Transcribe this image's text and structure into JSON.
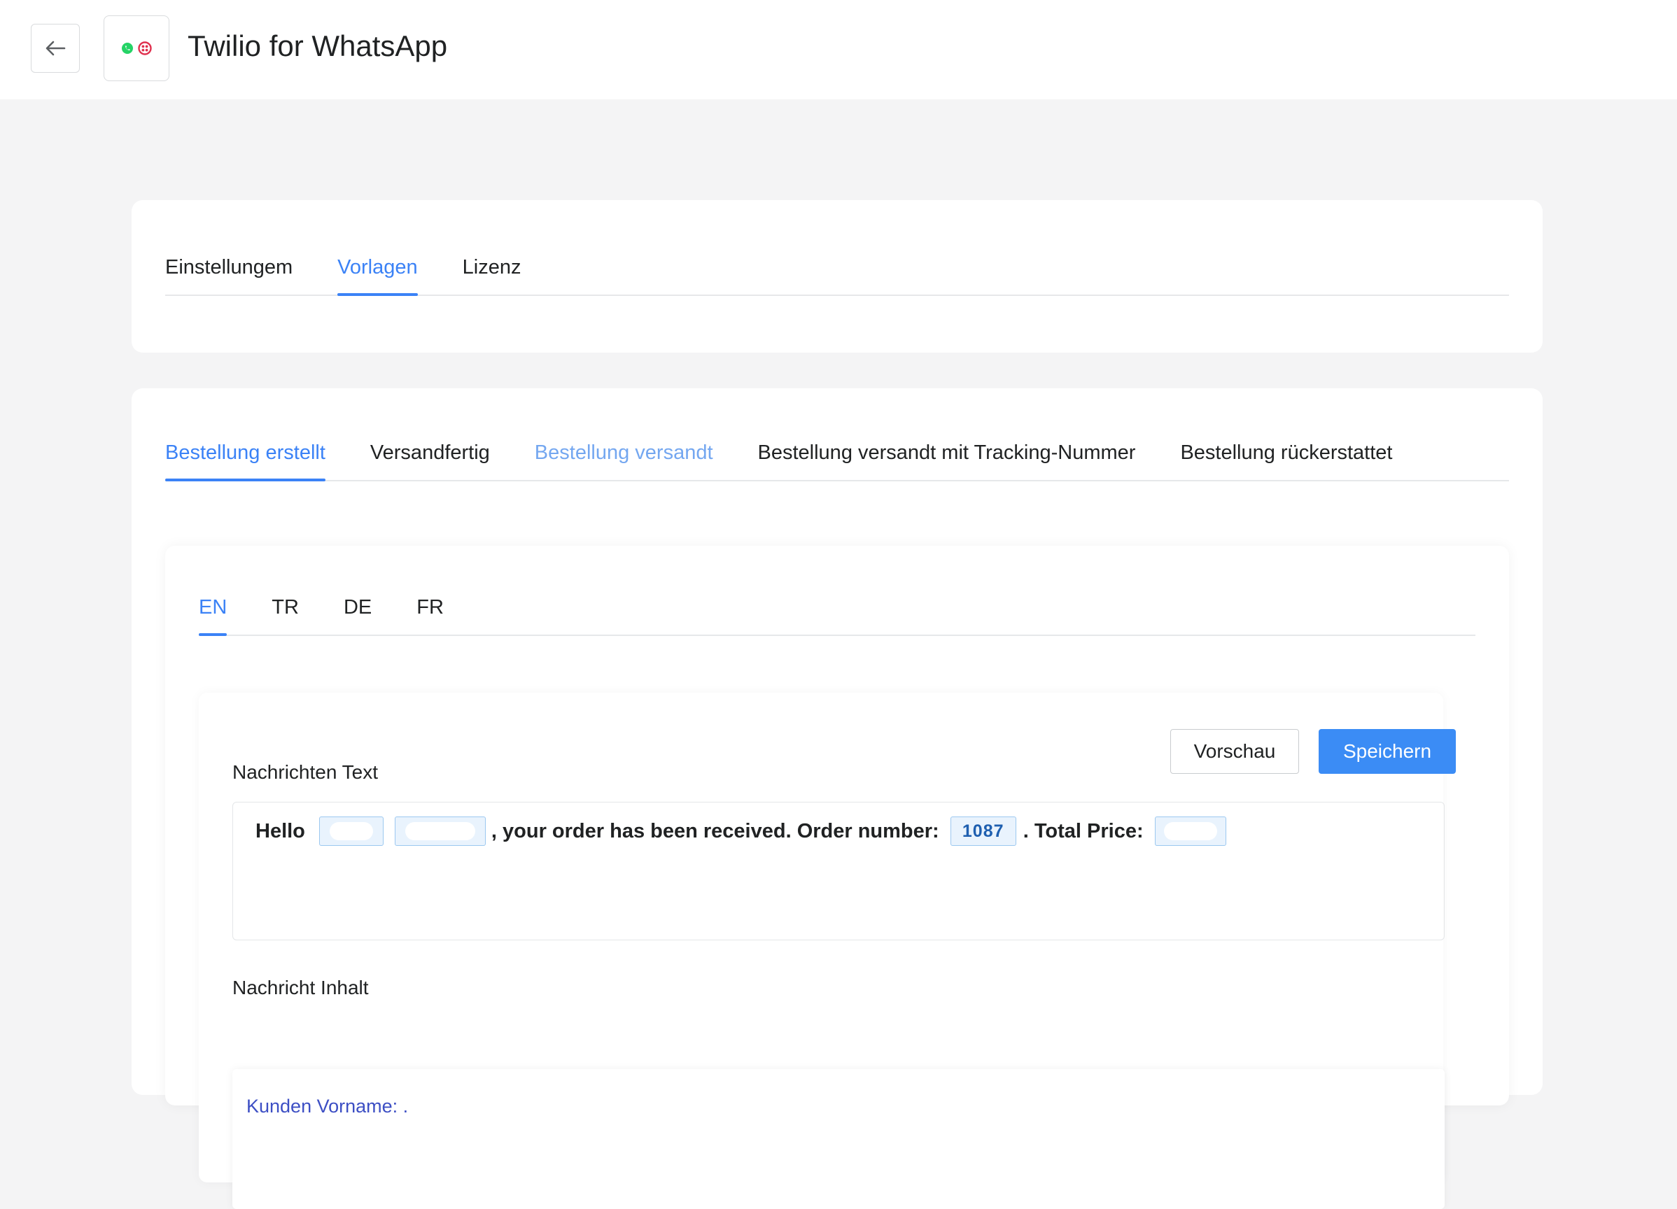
{
  "header": {
    "title": "Twilio for WhatsApp",
    "back_icon": "arrow-left-icon",
    "logo_icons": [
      "whatsapp-icon",
      "twilio-icon"
    ]
  },
  "main_tabs": [
    {
      "label": "Einstellungem",
      "active": false
    },
    {
      "label": "Vorlagen",
      "active": true
    },
    {
      "label": "Lizenz",
      "active": false
    }
  ],
  "event_tabs": [
    {
      "label": "Bestellung erstellt",
      "active": true
    },
    {
      "label": "Versandfertig",
      "active": false
    },
    {
      "label": "Bestellung versandt",
      "active": false
    },
    {
      "label": "Bestellung versandt mit Tracking-Nummer",
      "active": false
    },
    {
      "label": "Bestellung rückerstattet",
      "active": false
    }
  ],
  "language_tabs": [
    {
      "label": "EN",
      "active": true
    },
    {
      "label": "TR",
      "active": false
    },
    {
      "label": "DE",
      "active": false
    },
    {
      "label": "FR",
      "active": false
    }
  ],
  "editor": {
    "preview_button": "Vorschau",
    "save_button": "Speichern",
    "message_text_label": "Nachrichten Text",
    "message": {
      "hello": "Hello",
      "received": ", your order has been received. Order number:",
      "order_number": "1087",
      "total_price": ". Total Price:"
    },
    "message_content_label": "Nachricht Inhalt",
    "content_first_line": "Kunden Vorname: ."
  },
  "colors": {
    "accent": "#3b82f6",
    "save_button": "#3b8cf5",
    "chip_bg": "#e9f3fd",
    "chip_border": "#9cc8f0",
    "content_text": "#3d4fc4"
  }
}
